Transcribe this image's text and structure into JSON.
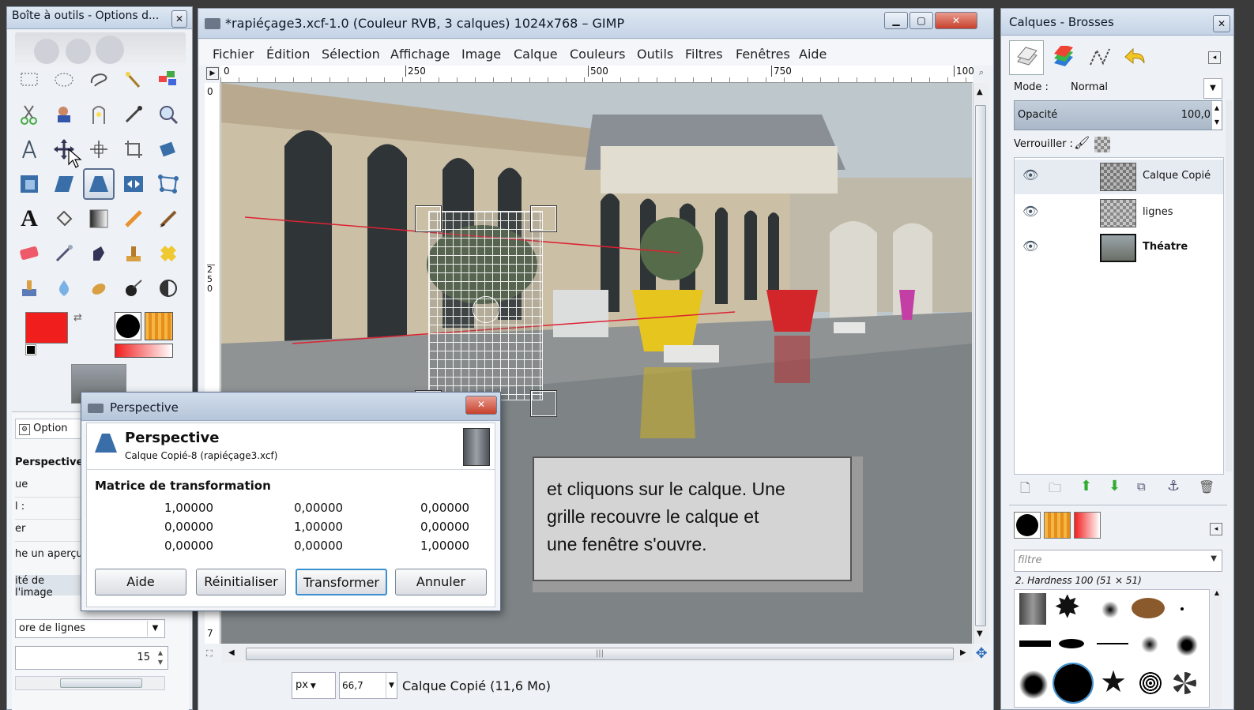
{
  "toolbox": {
    "title": "Boîte à outils - Options d...",
    "options_tab": "Option",
    "tool_name": "Perspective",
    "partial_rows": [
      "ue",
      "l :",
      "er",
      "he un aperçu",
      "ité de l'image"
    ],
    "grid_select": "ore de lignes",
    "number_value": "15"
  },
  "gimp": {
    "title": "*rapiéçage3.xcf-1.0 (Couleur RVB, 3 calques) 1024x768 – GIMP",
    "menu": [
      "Fichier",
      "Édition",
      "Sélection",
      "Affichage",
      "Image",
      "Calque",
      "Couleurs",
      "Outils",
      "Filtres",
      "Fenêtres",
      "Aide"
    ],
    "ruler_top": [
      "0",
      "250",
      "500",
      "750",
      "100"
    ],
    "ruler_left": [
      "0",
      "250"
    ],
    "ruler_left_bottom": "7",
    "unit": "px",
    "zoom": "66,7",
    "status": "Calque Copié (11,6 Mo)"
  },
  "layers": {
    "title": "Calques - Brosses",
    "mode_label": "Mode :",
    "mode_value": "Normal",
    "opacity_label": "Opacité",
    "opacity_value": "100,0",
    "lock_label": "Verrouiller :",
    "items": [
      {
        "name": "Calque Copié",
        "bold": false
      },
      {
        "name": "lignes",
        "bold": false
      },
      {
        "name": "Théatre",
        "bold": true
      }
    ],
    "filter_placeholder": "filtre",
    "brush_name": "2. Hardness 100 (51 × 51)"
  },
  "dialog": {
    "title": "Perspective",
    "heading": "Perspective",
    "subtitle": "Calque Copié-8 (rapiéçage3.xcf)",
    "matrix_label": "Matrice de transformation",
    "matrix": [
      [
        "1,00000",
        "0,00000",
        "0,00000"
      ],
      [
        "0,00000",
        "1,00000",
        "0,00000"
      ],
      [
        "0,00000",
        "0,00000",
        "1,00000"
      ]
    ],
    "buttons": {
      "help": "Aide",
      "reset": "Réinitialiser",
      "transform": "Transformer",
      "cancel": "Annuler"
    }
  },
  "callout": {
    "line1": "et cliquons sur le calque. Une",
    "line2": "grille recouvre le calque et",
    "line3": "une fenêtre s'ouvre."
  },
  "colors": {
    "fg": "#f11e1e",
    "bg": "#ffffff",
    "accent": "#3a8fd0"
  }
}
